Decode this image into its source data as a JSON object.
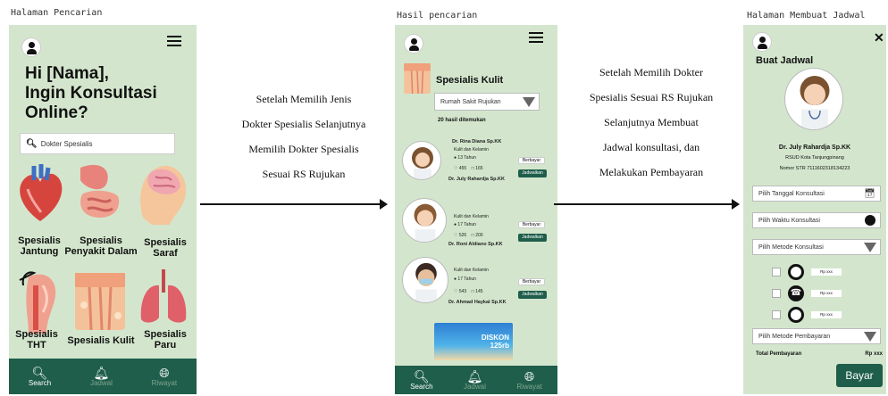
{
  "screen1": {
    "caption": "Halaman Pencarian",
    "greeting": "Hi [Nama],\nIngin Konsultasi\nOnline?",
    "search_placeholder": "Dokter Spesialis",
    "categories": [
      {
        "label": "Spesialis\nJantung"
      },
      {
        "label": "Spesialis\nPenyakit Dalam"
      },
      {
        "label": "Spesialis\nSaraf"
      },
      {
        "label": "Spesialis\nTHT"
      },
      {
        "label": "Spesialis Kulit"
      },
      {
        "label": "Spesialis\nParu"
      }
    ],
    "nav": [
      "Search",
      "Jadwal",
      "Riwayat"
    ]
  },
  "middle1": {
    "text": "Setelah Memilih Jenis\n\nDokter Spesialis Selanjutnya\n\nMemilih Dokter Spesialis\n\nSesuai RS Rujukan"
  },
  "screen2": {
    "caption": "Hasil pencarian",
    "title": "Spesialis Kulit",
    "hospital_select": "Rumah Sakit Rujukan",
    "result_count": "20 hasil ditemukan",
    "doctors": [
      {
        "name": "Dr. Rina Diana Sp.KK",
        "gender": "Kulit dan Kelamin",
        "exp": "13 Tahun",
        "likes": "455",
        "comments": "165",
        "sub": "Dr. July Rahardja Sp.KK",
        "fee": "Berbayar",
        "btn": "Jadwalkan"
      },
      {
        "name": "",
        "gender": "Kulit dan Kelamin",
        "exp": "17 Tahun",
        "likes": "526",
        "comments": "200",
        "sub": "Dr. Roni Aldiano Sp.KK",
        "fee": "Berbayar",
        "btn": "Jadwalkan"
      },
      {
        "name": "",
        "gender": "Kulit dan Kelamin",
        "exp": "17 Tahun",
        "likes": "543",
        "comments": "145",
        "sub": "Dr. Ahmad Haykal Sp.KK",
        "fee": "Berbayar",
        "btn": "Jadwalkan"
      }
    ],
    "promo": "DISKON 125rb",
    "nav": [
      "Search",
      "Jadwal",
      "Riwayat"
    ]
  },
  "middle2": {
    "text": "Setelah Memilih Dokter\n\nSpesialis Sesuai RS Rujukan\n\nSelanjutnya Membuat\n\nJadwal konsultasi,  dan\n\nMelakukan Pembayaran"
  },
  "screen3": {
    "caption": "Halaman Membuat Jadwal",
    "title": "Buat Jadwal",
    "doctor_name": "Dr. July Rahardja Sp.KK",
    "hospital": "RSUD Kota Tanjungpinang",
    "str": "Nomor STR 7111602318134223",
    "date_field": "Pilih Tanggal Konsultasi",
    "time_field": "Pilih Waktu Konsultasi",
    "method_field": "Pilih Metode Konsultasi",
    "methods": [
      {
        "price": "Rp xxx"
      },
      {
        "price": "Rp xxx"
      },
      {
        "price": "Rp xxx"
      }
    ],
    "payment_field": "Pilih Metode Pembayaran",
    "total_label": "Total Pembayaran",
    "total_value": "Rp xxx",
    "pay_button": "Bayar"
  }
}
